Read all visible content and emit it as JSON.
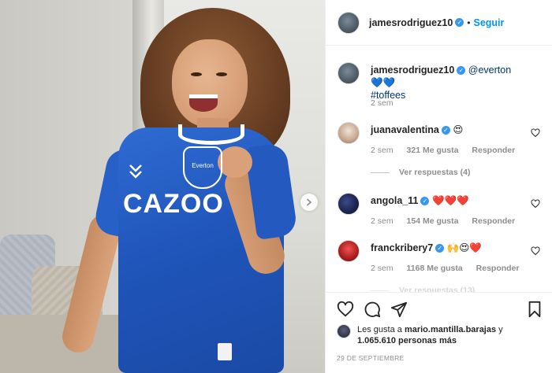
{
  "post": {
    "author": "jamesrodriguez10",
    "follow_label": "Seguir",
    "separator": "•",
    "caption_mention": "@everton",
    "caption_emojis": "💙💙",
    "caption_hashtag": "#toffees",
    "caption_time": "2 sem",
    "photo": {
      "jersey_crest_text": "Everton",
      "jersey_sponsor": "CAZOO",
      "next_icon": "chevron-right-icon"
    }
  },
  "comments": [
    {
      "user": "juanavalentina",
      "text": "😍",
      "time": "2 sem",
      "likes": "321 Me gusta",
      "reply_label": "Responder",
      "view_replies": "Ver respuestas (4)"
    },
    {
      "user": "angola_11",
      "text": "❤️❤️❤️",
      "time": "2 sem",
      "likes": "154 Me gusta",
      "reply_label": "Responder"
    },
    {
      "user": "franckribery7",
      "text": "🙌😍❤️",
      "time": "2 sem",
      "likes": "1168 Me gusta",
      "reply_label": "Responder",
      "view_replies": "Ver respuestas (13)"
    }
  ],
  "actions": {
    "like_icon": "heart-icon",
    "comment_icon": "comment-icon",
    "share_icon": "share-icon",
    "save_icon": "bookmark-icon"
  },
  "likes_summary": {
    "prefix": "Les gusta a ",
    "user": "mario.mantilla.barajas",
    "middle": " y",
    "count": "1.065.610 personas más"
  },
  "date": "29 DE SEPTIEMBRE",
  "colors": {
    "link_blue": "#0095f6",
    "verified_blue": "#3897f0",
    "jersey_blue": "#1f54b8",
    "muted_gray": "#8e8e8e"
  }
}
